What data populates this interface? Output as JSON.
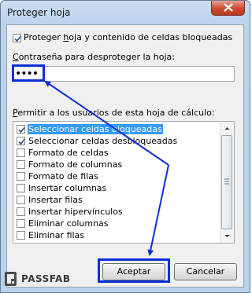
{
  "dialog": {
    "title": "Proteger hoja",
    "protect_checkbox_pre": "Proteger ",
    "protect_checkbox_u": "h",
    "protect_checkbox_post": "oja y contenido de celdas bloqueadas",
    "protect_checked": true,
    "password_label_u": "C",
    "password_label_rest": "ontraseña para desproteger la hoja:",
    "password_value": "••••",
    "permissions_label_u": "P",
    "permissions_label_rest": "ermitir a los usuarios de esta hoja de cálculo:",
    "permissions": [
      {
        "label": "Seleccionar celdas bloqueadas",
        "checked": true,
        "selected": true
      },
      {
        "label": "Seleccionar celdas desbloqueadas",
        "checked": true,
        "selected": false
      },
      {
        "label": "Formato de celdas",
        "checked": false,
        "selected": false
      },
      {
        "label": "Formato de columnas",
        "checked": false,
        "selected": false
      },
      {
        "label": "Formato de filas",
        "checked": false,
        "selected": false
      },
      {
        "label": "Insertar columnas",
        "checked": false,
        "selected": false
      },
      {
        "label": "Insertar filas",
        "checked": false,
        "selected": false
      },
      {
        "label": "Insertar hipervínculos",
        "checked": false,
        "selected": false
      },
      {
        "label": "Eliminar columnas",
        "checked": false,
        "selected": false
      },
      {
        "label": "Eliminar filas",
        "checked": false,
        "selected": false
      }
    ],
    "ok_label": "Aceptar",
    "cancel_label": "Cancelar"
  },
  "watermark": {
    "text": "PASSFAB"
  },
  "colors": {
    "highlight": "#0a2fd8",
    "selection": "#3399ff",
    "close_button": "#c9492e"
  }
}
